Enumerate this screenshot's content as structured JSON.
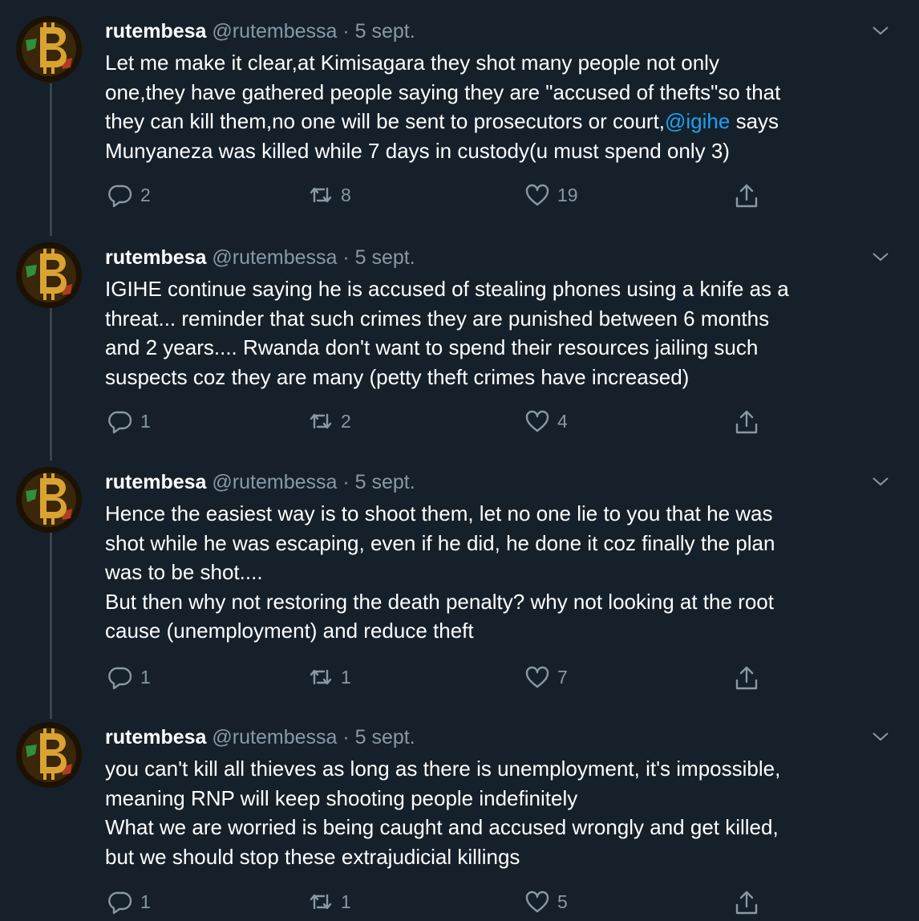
{
  "tweets": [
    {
      "name": "rutembesa",
      "handle": "@rutembessa",
      "separator": "·",
      "date": "5 sept.",
      "text_before": "Let me make it clear,at Kimisagara they shot many people not only\none,they have gathered people saying they are \"accused of thefts\"so that\nthey can kill them,no one will be sent to prosecutors or court,",
      "mention": "@igihe",
      "text_after": " says\nMunyaneza was killed while 7 days in custody(u must spend only 3)",
      "replies": "2",
      "retweets": "8",
      "likes": "19"
    },
    {
      "name": "rutembesa",
      "handle": "@rutembessa",
      "separator": "·",
      "date": "5 sept.",
      "text_before": "IGIHE continue saying he is accused of stealing phones using a knife as a\nthreat... reminder that such crimes they are punished between 6 months\nand 2 years.... Rwanda don't want to spend their resources jailing such\nsuspects coz they are many (petty theft crimes have increased)",
      "mention": "",
      "text_after": "",
      "replies": "1",
      "retweets": "2",
      "likes": "4"
    },
    {
      "name": "rutembesa",
      "handle": "@rutembessa",
      "separator": "·",
      "date": "5 sept.",
      "text_before": "Hence the easiest way is to shoot them, let no one lie to you that he was\nshot while he was escaping, even if he did, he done it coz finally the plan\nwas to be shot....\nBut then why not restoring the death penalty? why not looking at the root\ncause (unemployment) and reduce theft",
      "mention": "",
      "text_after": "",
      "replies": "1",
      "retweets": "1",
      "likes": "7"
    },
    {
      "name": "rutembesa",
      "handle": "@rutembessa",
      "separator": "·",
      "date": "5 sept.",
      "text_before": "you can't kill all thieves as long as there is unemployment, it's impossible,\nmeaning RNP will keep shooting people indefinitely\nWhat we are worried is being caught and accused wrongly and get killed,\nbut we should stop these extrajudicial killings",
      "mention": "",
      "text_after": "",
      "replies": "1",
      "retweets": "1",
      "likes": "5"
    }
  ],
  "icons": {
    "avatar": "bitcoin-logo-icon",
    "menu": "chevron-down-icon",
    "reply": "reply-bubble-icon",
    "retweet": "retweet-icon",
    "like": "heart-icon",
    "share": "share-icon"
  },
  "colors": {
    "background": "#15202b",
    "text": "#ffffff",
    "secondary": "#8899a6",
    "link": "#1da1f2",
    "thread_line": "#38444d",
    "avatar_gold": "#d9a332"
  }
}
